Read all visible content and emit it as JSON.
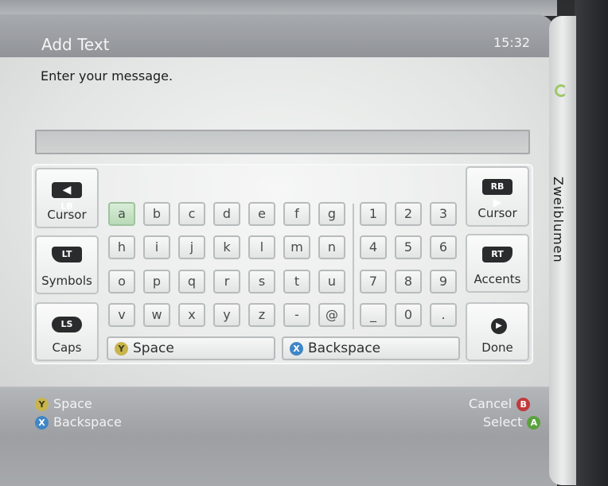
{
  "header": {
    "title": "Add Text",
    "time": "15:32"
  },
  "prompt": "Enter your message.",
  "text_field": {
    "value": ""
  },
  "keyboard": {
    "left_keys": [
      {
        "badge": "LB",
        "label": "Cursor"
      },
      {
        "badge": "LT",
        "label": "Symbols"
      },
      {
        "badge": "LS",
        "label": "Caps"
      }
    ],
    "right_keys": [
      {
        "badge": "RB",
        "label": "Cursor"
      },
      {
        "badge": "RT",
        "label": "Accents"
      },
      {
        "badge": "",
        "label": "Done"
      }
    ],
    "rows": [
      [
        "a",
        "b",
        "c",
        "d",
        "e",
        "f",
        "g",
        "1",
        "2",
        "3"
      ],
      [
        "h",
        "i",
        "j",
        "k",
        "l",
        "m",
        "n",
        "4",
        "5",
        "6"
      ],
      [
        "o",
        "p",
        "q",
        "r",
        "s",
        "t",
        "u",
        "7",
        "8",
        "9"
      ],
      [
        "v",
        "w",
        "x",
        "y",
        "z",
        "-",
        "@",
        "_",
        "0",
        "."
      ]
    ],
    "space_label": "Space",
    "space_button": "Y",
    "backspace_label": "Backspace",
    "backspace_button": "X"
  },
  "footer": {
    "left": [
      {
        "button": "Y",
        "label": "Space"
      },
      {
        "button": "X",
        "label": "Backspace"
      }
    ],
    "right": [
      {
        "button": "B",
        "label": "Cancel"
      },
      {
        "button": "A",
        "label": "Select"
      }
    ]
  },
  "side_tab": {
    "label": "Zweiblumen"
  },
  "colors": {
    "y_button": "#c8b54b",
    "x_button": "#3f86c6",
    "b_button": "#c23a3a",
    "a_button": "#5aa23d",
    "selected_key": "#c8e3c7"
  },
  "icons": {
    "play": "play-circle-icon",
    "left_arrow": "arrow-left-icon",
    "right_arrow": "arrow-right-icon",
    "ring": "xbox-ring-icon"
  }
}
